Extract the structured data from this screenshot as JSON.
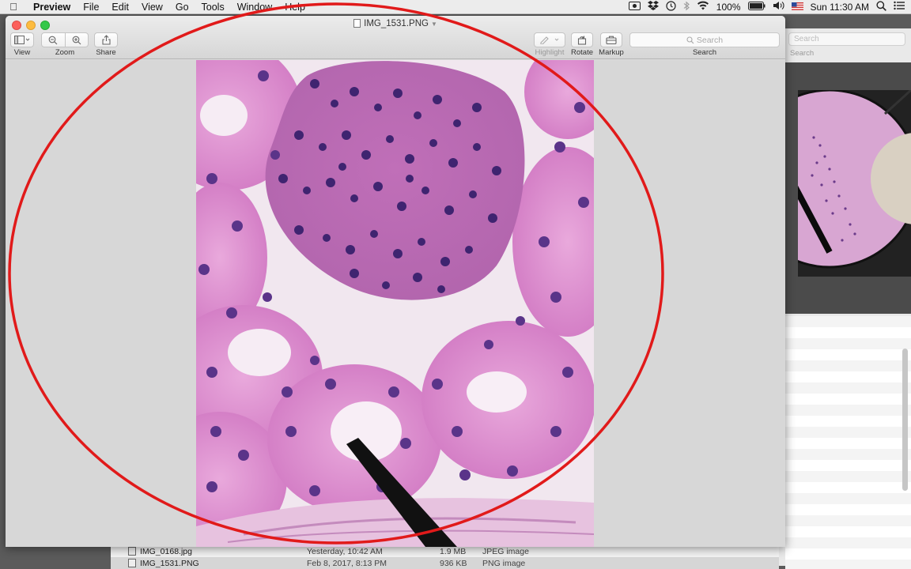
{
  "menubar": {
    "app": "Preview",
    "items": [
      "File",
      "Edit",
      "View",
      "Go",
      "Tools",
      "Window",
      "Help"
    ],
    "battery": "100%",
    "clock": "Sun 11:30 AM"
  },
  "window": {
    "title": "IMG_1531.PNG",
    "toolbar": {
      "view_label": "View",
      "zoom_label": "Zoom",
      "share_label": "Share",
      "highlight_label": "Highlight",
      "rotate_label": "Rotate",
      "markup_label": "Markup",
      "search_placeholder": "Search",
      "search_label": "Search"
    }
  },
  "background_window": {
    "search_placeholder": "Search",
    "search_label": "Search"
  },
  "finder_rows": [
    {
      "name": "IMG_0168.jpg",
      "date": "Yesterday, 10:42 AM",
      "size": "1.9 MB",
      "kind": "JPEG image"
    },
    {
      "name": "IMG_1531.PNG",
      "date": "Feb 8, 2017, 8:13 PM",
      "size": "936 KB",
      "kind": "PNG image"
    }
  ],
  "colors": {
    "annotation": "#e11a1a",
    "tissue_pink": "#d486c8",
    "nuclei": "#4b2a78"
  }
}
